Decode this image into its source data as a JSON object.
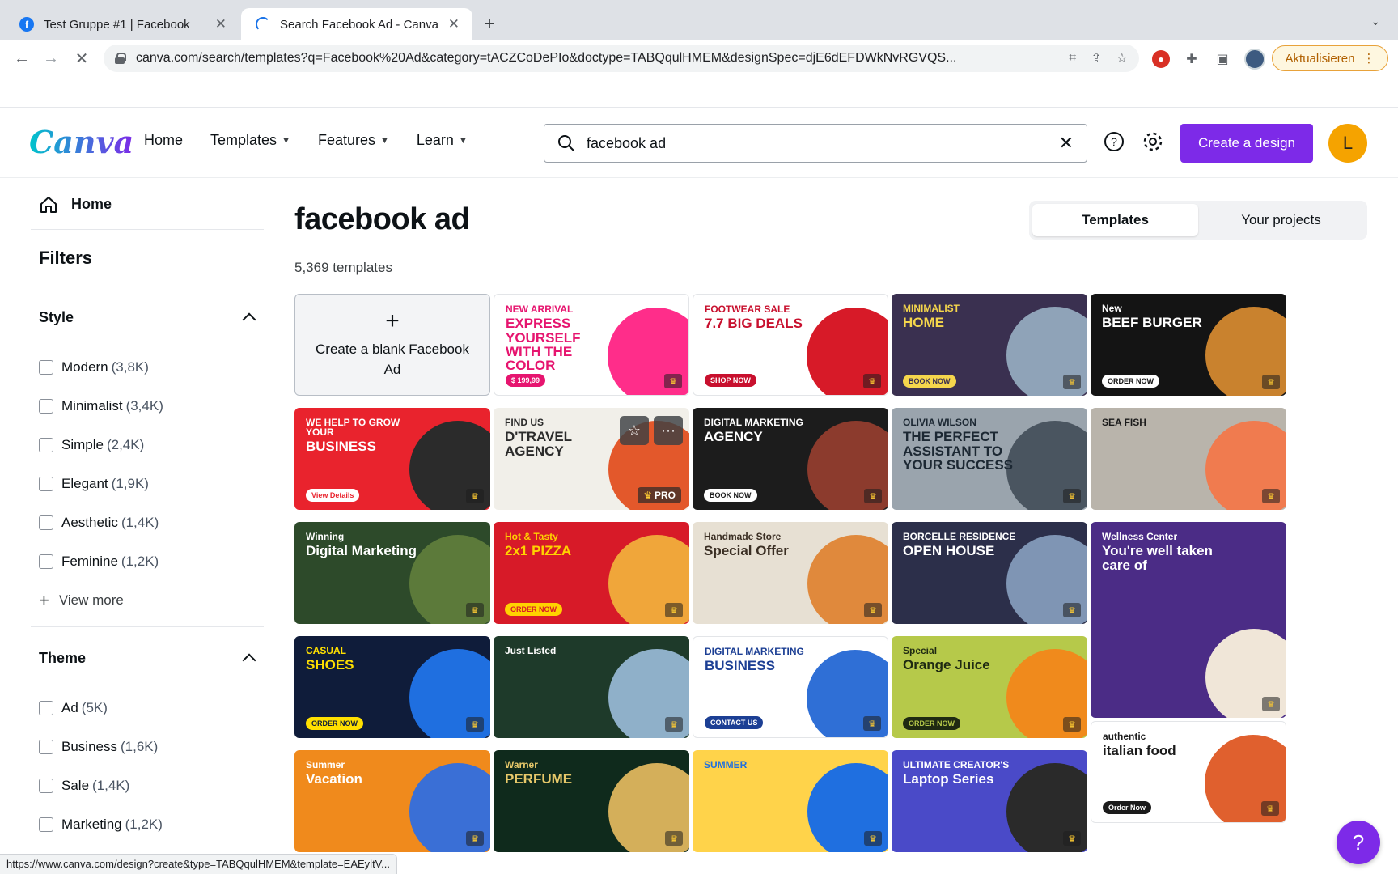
{
  "browser": {
    "tabs": [
      {
        "title": "Test Gruppe #1 | Facebook",
        "favicon": "facebook-icon"
      },
      {
        "title": "Search Facebook Ad - Canva",
        "favicon": "loading-spinner-icon"
      }
    ],
    "url": "canva.com/search/templates?q=Facebook%20Ad&category=tACZCoDePIo&doctype=TABQqulHMEM&designSpec=djE6dEFDWkNvRGVQS...",
    "update_label": "Aktualisieren",
    "status_url": "https://www.canva.com/design?create&type=TABQqulHMEM&template=EAEyltV..."
  },
  "header": {
    "logo": "Canva",
    "nav": [
      {
        "label": "Home",
        "has_menu": false
      },
      {
        "label": "Templates",
        "has_menu": true
      },
      {
        "label": "Features",
        "has_menu": true
      },
      {
        "label": "Learn",
        "has_menu": true
      }
    ],
    "search_value": "facebook ad",
    "create_label": "Create a design",
    "avatar_initial": "L",
    "accent": "#7d2ae8"
  },
  "sidebar": {
    "home_label": "Home",
    "filters_title": "Filters",
    "style": {
      "title": "Style",
      "options": [
        {
          "label": "Modern",
          "count": "(3,8K)"
        },
        {
          "label": "Minimalist",
          "count": "(3,4K)"
        },
        {
          "label": "Simple",
          "count": "(2,4K)"
        },
        {
          "label": "Elegant",
          "count": "(1,9K)"
        },
        {
          "label": "Aesthetic",
          "count": "(1,4K)"
        },
        {
          "label": "Feminine",
          "count": "(1,2K)"
        }
      ],
      "view_more": "View more"
    },
    "theme": {
      "title": "Theme",
      "options": [
        {
          "label": "Ad",
          "count": "(5K)"
        },
        {
          "label": "Business",
          "count": "(1,6K)"
        },
        {
          "label": "Sale",
          "count": "(1,4K)"
        },
        {
          "label": "Marketing",
          "count": "(1,2K)"
        }
      ]
    }
  },
  "main": {
    "title": "facebook ad",
    "count": "5,369 templates",
    "tabs": [
      {
        "label": "Templates"
      },
      {
        "label": "Your projects"
      }
    ],
    "blank_label": "Create a blank Facebook Ad",
    "templates": [
      {
        "line1": "NEW ARRIVAL",
        "line2": "EXPRESS YOURSELF WITH THE COLOR",
        "line3": "$ 199,99",
        "bg": "#ffffff",
        "fg": "#e6156f",
        "art": "#ff2d8a"
      },
      {
        "line1": "FOOTWEAR SALE",
        "line2": "7.7 BIG DEALS",
        "line3": "SHOP NOW",
        "bg": "#ffffff",
        "fg": "#c8102e",
        "art": "#d71a28"
      },
      {
        "line1": "MINIMALIST",
        "line2": "HOME",
        "line3": "BOOK NOW",
        "bg": "#3a3050",
        "fg": "#f5d64c",
        "art": "#8fa3b8"
      },
      {
        "line1": "New",
        "line2": "BEEF BURGER",
        "line3": "ORDER NOW",
        "bg": "#141414",
        "fg": "#ffffff",
        "art": "#c9822e"
      },
      {
        "line1": "WE HELP TO GROW YOUR",
        "line2": "BUSINESS",
        "line3": "View Details",
        "bg": "#e9232d",
        "fg": "#ffffff",
        "art": "#2b2b2b"
      },
      {
        "line1": "FIND US",
        "line2": "D'TRAVEL AGENCY",
        "line3": "",
        "bg": "#f1efe9",
        "fg": "#2b2b2b",
        "art": "#e3582b"
      },
      {
        "line1": "DIGITAL MARKETING",
        "line2": "AGENCY",
        "line3": "BOOK NOW",
        "bg": "#1c1c1c",
        "fg": "#ffffff",
        "art": "#8c3b2d"
      },
      {
        "line1": "OLIVIA WILSON",
        "line2": "THE PERFECT ASSISTANT TO YOUR SUCCESS",
        "line3": "",
        "bg": "#9aa4ad",
        "fg": "#1c2833",
        "art": "#4a5560"
      },
      {
        "line1": "SEA FISH",
        "line2": "",
        "line3": "",
        "bg": "#b9b4ab",
        "fg": "#1b1b1b",
        "art": "#f07b4f"
      },
      {
        "line1": "Winning",
        "line2": "Digital Marketing",
        "line3": "",
        "bg": "#2d4a2a",
        "fg": "#ffffff",
        "art": "#5c7a3a"
      },
      {
        "line1": "Hot & Tasty",
        "line2": "2x1 PIZZA",
        "line3": "ORDER NOW",
        "bg": "#d71a28",
        "fg": "#ffd200",
        "art": "#f0a63a"
      },
      {
        "line1": "Handmade Store",
        "line2": "Special Offer",
        "line3": "",
        "bg": "#e7e0d3",
        "fg": "#3a2e23",
        "art": "#e0893c"
      },
      {
        "line1": "BORCELLE RESIDENCE",
        "line2": "OPEN HOUSE",
        "line3": "",
        "bg": "#2c2f4a",
        "fg": "#ffffff",
        "art": "#7f95b4"
      },
      {
        "line1": "Wellness Center",
        "line2": "You're well taken care of",
        "line3": "",
        "bg": "#4b2c86",
        "fg": "#ffffff",
        "art": "#f0e6d8"
      },
      {
        "line1": "CASUAL",
        "line2": "SHOES",
        "line3": "ORDER NOW",
        "bg": "#0f1c3a",
        "fg": "#ffe000",
        "art": "#1f6fe0"
      },
      {
        "line1": "Just Listed",
        "line2": "",
        "line3": "",
        "bg": "#1e3a2a",
        "fg": "#ffffff",
        "art": "#8fb0c9"
      },
      {
        "line1": "DIGITAL MARKETING",
        "line2": "BUSINESS",
        "line3": "CONTACT US",
        "bg": "#ffffff",
        "fg": "#1c3f94",
        "art": "#2f6fd6"
      },
      {
        "line1": "Special",
        "line2": "Orange Juice",
        "line3": "ORDER NOW",
        "bg": "#b6c94a",
        "fg": "#1f2a12",
        "art": "#f08a1c"
      },
      {
        "line1": "authentic",
        "line2": "italian food",
        "line3": "Order Now",
        "bg": "#ffffff",
        "fg": "#1b1b1b",
        "art": "#e0602e"
      },
      {
        "line1": "Summer",
        "line2": "Vacation",
        "line3": "",
        "bg": "#f08a1c",
        "fg": "#ffffff",
        "art": "#3a6fd6"
      },
      {
        "line1": "Warner",
        "line2": "PERFUME",
        "line3": "",
        "bg": "#0f2a1c",
        "fg": "#e8c96a",
        "art": "#d4af5a"
      },
      {
        "line1": "SUMMER",
        "line2": "",
        "line3": "",
        "bg": "#ffd34a",
        "fg": "#1f6fe0",
        "art": "#1f6fe0"
      },
      {
        "line1": "ULTIMATE CREATOR'S",
        "line2": "Laptop Series",
        "line3": "",
        "bg": "#4a4ac8",
        "fg": "#ffffff",
        "art": "#2a2a2a"
      }
    ]
  }
}
